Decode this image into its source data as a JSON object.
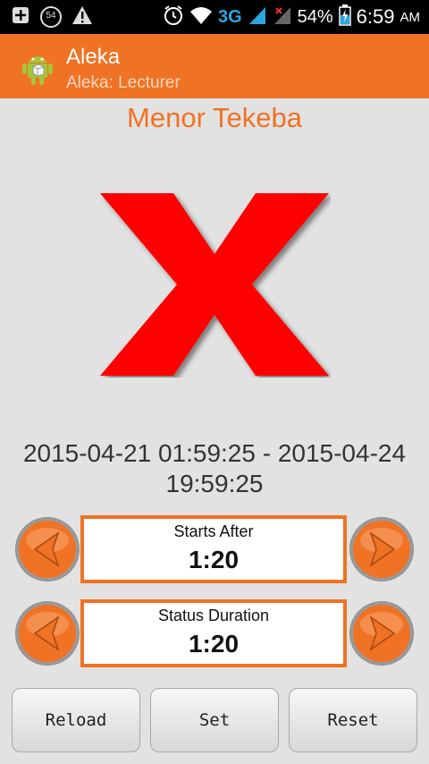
{
  "status_bar": {
    "left_icons": [
      "add-box-icon",
      "notification-54-icon",
      "warning-icon"
    ],
    "notification_count": "54",
    "network_type": "3G",
    "battery": "54%",
    "time": "6:59",
    "ampm": "AM"
  },
  "app": {
    "title": "Aleka",
    "subtitle": "Aleka: Lecturer",
    "icon": "android-icon"
  },
  "person": {
    "name": "Menor Tekeba"
  },
  "status": {
    "icon": "red-x-icon",
    "color": "#ff0000"
  },
  "date_range": {
    "line1": "2015-04-21 01:59:25 - 2015-04-24",
    "line2": "19:59:25"
  },
  "starts_after": {
    "label": "Starts After",
    "value": "1:20"
  },
  "status_duration": {
    "label": "Status Duration",
    "value": "1:20"
  },
  "buttons": {
    "reload": "Reload",
    "set": "Set",
    "reset": "Reset"
  },
  "colors": {
    "accent": "#f07224",
    "background": "#e2e2e2",
    "status_red": "#ff0000"
  }
}
